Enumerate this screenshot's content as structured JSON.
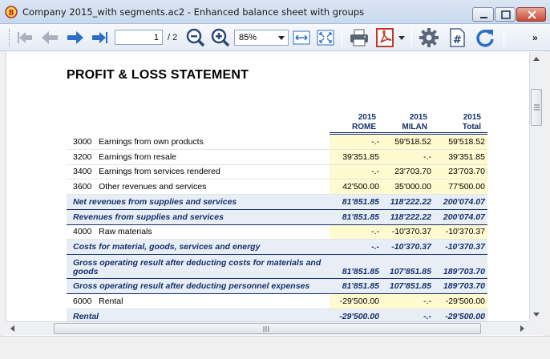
{
  "window": {
    "title": "Company 2015_with segments.ac2 - Enhanced balance sheet with groups"
  },
  "toolbar": {
    "page_current": "1",
    "page_total": "/ 2",
    "zoom": "85%",
    "overflow": "»",
    "icons": [
      "first-page-icon",
      "previous-page-icon",
      "next-page-icon",
      "last-page-icon",
      "zoom-out-icon",
      "zoom-in-icon",
      "fit-width-icon",
      "fit-page-icon",
      "print-icon",
      "pdf-icon",
      "settings-icon",
      "page-number-icon",
      "refresh-icon"
    ]
  },
  "report": {
    "title": "PROFIT & LOSS STATEMENT",
    "columns": [
      {
        "year": "2015",
        "label": "ROME"
      },
      {
        "year": "2015",
        "label": "MILAN"
      },
      {
        "year": "2015",
        "label": "Total"
      }
    ],
    "rows": [
      {
        "type": "account",
        "account": "3000",
        "description": "Earnings from own products",
        "rome": "-.-",
        "milan": "59'518.52",
        "total": "59'518.52"
      },
      {
        "type": "account",
        "account": "3200",
        "description": "Earnings from resale",
        "rome": "39'351.85",
        "milan": "-.-",
        "total": "39'351.85"
      },
      {
        "type": "account",
        "account": "3400",
        "description": "Earnings from services rendered",
        "rome": "-.-",
        "milan": "23'703.70",
        "total": "23'703.70"
      },
      {
        "type": "account",
        "account": "3600",
        "description": "Other revenues and services",
        "rome": "42'500.00",
        "milan": "35'000.00",
        "total": "77'500.00"
      },
      {
        "type": "total",
        "description": "Net revenues from supplies and services",
        "rome": "81'851.85",
        "milan": "118'222.22",
        "total": "200'074.07"
      },
      {
        "type": "total",
        "description": "Revenues from supplies and services",
        "rome": "81'851.85",
        "milan": "118'222.22",
        "total": "200'074.07"
      },
      {
        "type": "account",
        "account": "4000",
        "description": "Raw materials",
        "rome": "-.-",
        "milan": "-10'370.37",
        "total": "-10'370.37"
      },
      {
        "type": "total",
        "description": "Costs for material, goods, services and energy",
        "rome": "-.-",
        "milan": "-10'370.37",
        "total": "-10'370.37"
      },
      {
        "type": "total-tall",
        "description": "Gross operating result after deducting costs for materials and goods",
        "rome": "81'851.85",
        "milan": "107'851.85",
        "total": "189'703.70"
      },
      {
        "type": "total",
        "description": "Gross operating result after deducting personnel expenses",
        "rome": "81'851.85",
        "milan": "107'851.85",
        "total": "189'703.70"
      },
      {
        "type": "account",
        "account": "6000",
        "description": "Rental",
        "rome": "-29'500.00",
        "milan": "-.-",
        "total": "-29'500.00"
      },
      {
        "type": "total",
        "description": "Rental",
        "rome": "-29'500.00",
        "milan": "-.-",
        "total": "-29'500.00"
      }
    ]
  }
}
